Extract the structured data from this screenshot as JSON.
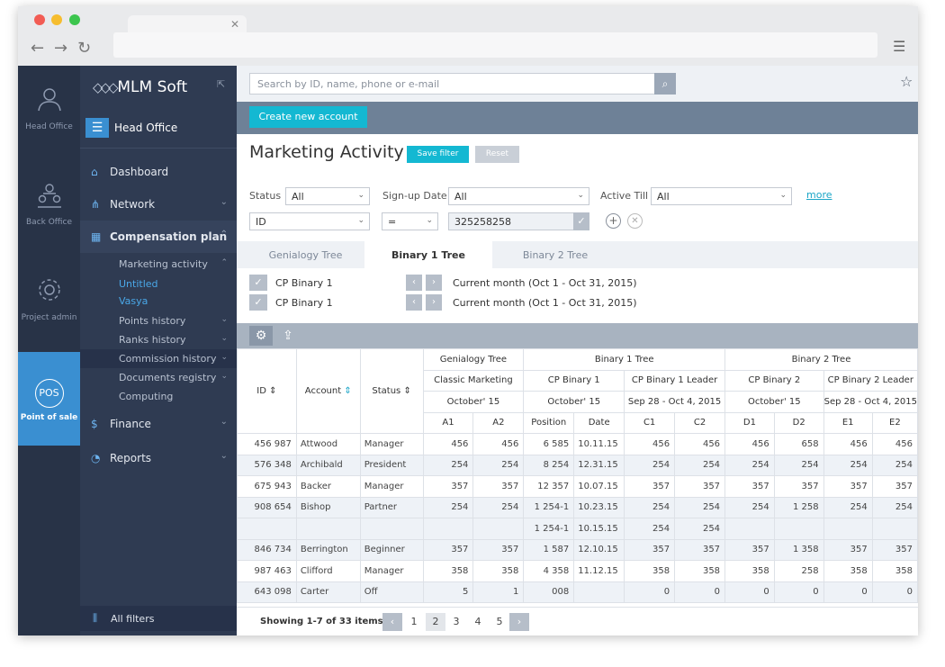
{
  "brand": {
    "name": "MLM Soft",
    "office": "Head Office"
  },
  "rail": [
    {
      "label": "Head Office",
      "icon": "user-icon"
    },
    {
      "label": "Back Office",
      "icon": "team-icon"
    },
    {
      "label": "Project admin",
      "icon": "gear-icon"
    },
    {
      "label": "Point of sale",
      "badge": "POS",
      "icon": "pos-icon"
    }
  ],
  "sidebar": {
    "items": [
      {
        "label": "Dashboard",
        "icon": "home-icon"
      },
      {
        "label": "Network",
        "icon": "network-icon"
      },
      {
        "label": "Compensation plan",
        "icon": "calc-icon"
      },
      {
        "label": "Finance",
        "icon": "finance-icon"
      },
      {
        "label": "Reports",
        "icon": "pie-icon"
      }
    ],
    "sub": [
      "Marketing activity",
      "Untitled",
      "Vasya",
      "Points history",
      "Ranks history",
      "Commission history",
      "Documents registry",
      "Computing"
    ],
    "all_filters": "All filters"
  },
  "search": {
    "placeholder": "Search by ID, name, phone or e-mail"
  },
  "create_button": "Create new account",
  "page_title": "Marketing Activity",
  "save_filter": "Save filter",
  "reset": "Reset",
  "filters": {
    "status_label": "Status",
    "status_value": "All",
    "signup_label": "Sign-up Date",
    "signup_value": "All",
    "active_label": "Active Till",
    "active_value": "All",
    "more": "more",
    "field": "ID",
    "op": "=",
    "value": "325258258"
  },
  "tabs": [
    "Genialogy Tree",
    "Binary 1 Tree",
    "Binary 2 Tree"
  ],
  "tree_rows": [
    {
      "label": "CP Binary 1",
      "period": "Current month (Oct 1 - Oct 31, 2015)"
    },
    {
      "label": "CP Binary 1",
      "period": "Current month (Oct 1 - Oct 31, 2015)"
    }
  ],
  "table": {
    "h_id": "ID",
    "h_account": "Account",
    "h_status": "Status",
    "groups": [
      "Genialogy Tree",
      "Binary 1 Tree",
      "Binary 2 Tree"
    ],
    "sub": [
      "Classic Marketing",
      "CP Binary 1",
      "CP Binary 1 Leader",
      "CP Binary 2",
      "CP Binary 2 Leader"
    ],
    "periods": [
      "October' 15",
      "October' 15",
      "Sep 28 - Oct 4, 2015",
      "October' 15",
      "Sep 28 - Oct 4, 2015"
    ],
    "cols": [
      "A1",
      "A2",
      "Position",
      "Date",
      "C1",
      "C2",
      "D1",
      "D2",
      "E1",
      "E2"
    ],
    "rows": [
      [
        "456 987",
        "Attwood",
        "Manager",
        "456",
        "456",
        "6 585",
        "10.11.15",
        "456",
        "456",
        "456",
        "658",
        "456",
        "456"
      ],
      [
        "576 348",
        "Archibald",
        "President",
        "254",
        "254",
        "8 254",
        "12.31.15",
        "254",
        "254",
        "254",
        "254",
        "254",
        "254"
      ],
      [
        "675 943",
        "Backer",
        "Manager",
        "357",
        "357",
        "12 357",
        "10.07.15",
        "357",
        "357",
        "357",
        "357",
        "357",
        "357"
      ],
      [
        "908 654",
        "Bishop",
        "Partner",
        "254",
        "254",
        "1 254-1",
        "10.23.15",
        "254",
        "254",
        "254",
        "1 258",
        "254",
        "254"
      ],
      [
        "",
        "",
        "",
        "",
        "",
        "1 254-1",
        "10.15.15",
        "254",
        "254",
        "",
        "",
        "",
        ""
      ],
      [
        "846 734",
        "Berrington",
        "Beginner",
        "357",
        "357",
        "1 587",
        "12.10.15",
        "357",
        "357",
        "357",
        "1 358",
        "357",
        "357"
      ],
      [
        "987 463",
        "Clifford",
        "Manager",
        "358",
        "358",
        "4 358",
        "11.12.15",
        "358",
        "358",
        "358",
        "258",
        "358",
        "358"
      ],
      [
        "643 098",
        "Carter",
        "Off",
        "5",
        "1",
        "008",
        "",
        "0",
        "0",
        "0",
        "0",
        "0",
        "0"
      ]
    ]
  },
  "pager": {
    "info": "Showing 1-7 of 33 items",
    "pages": [
      "1",
      "2",
      "3",
      "4",
      "5"
    ]
  }
}
